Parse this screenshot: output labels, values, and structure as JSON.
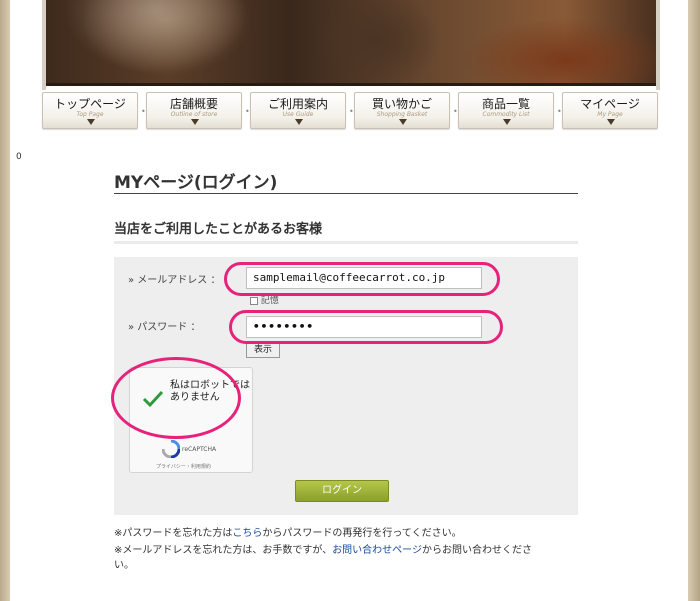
{
  "counter": "0",
  "nav": [
    {
      "jp": "トップページ",
      "en": "Top Page"
    },
    {
      "jp": "店舗概要",
      "en": "Outline of store"
    },
    {
      "jp": "ご利用案内",
      "en": "Use Guide"
    },
    {
      "jp": "買い物かご",
      "en": "Shopping Basket"
    },
    {
      "jp": "商品一覧",
      "en": "Commodity List"
    },
    {
      "jp": "マイページ",
      "en": "My Page"
    }
  ],
  "page_title": "MYページ(ログイン)",
  "section_title": "当店をご利用したことがあるお客様",
  "form": {
    "email_label": "» メールアドレス ：",
    "email_value": "samplemail@coffeecarrot.co.jp",
    "remember_label": "記憶",
    "password_label": "» パスワード ：",
    "password_value": "••••••••",
    "show_button": "表示",
    "login_button": "ログイン"
  },
  "recaptcha": {
    "text": "私はロボットではありません",
    "brand": "reCAPTCHA",
    "links": "プライバシー・利用規約"
  },
  "notes": {
    "line1_pre": "※パスワードを忘れた方は",
    "line1_link": "こちら",
    "line1_post": "からパスワードの再発行を行ってください。",
    "line2_pre": "※メールアドレスを忘れた方は、お手数ですが、",
    "line2_link": "お問い合わせページ",
    "line2_post": "からお問い合わせくださ",
    "line3": "い。"
  },
  "colors": {
    "highlight": "#e6227a",
    "login_button": "#9fb33a",
    "check": "#2e9a3e"
  }
}
